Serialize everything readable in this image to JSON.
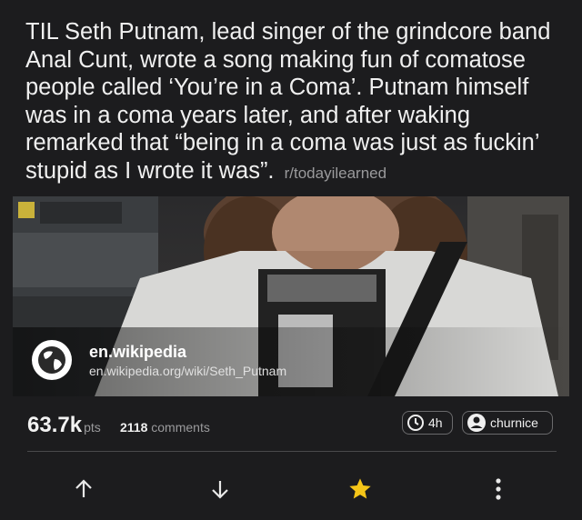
{
  "post": {
    "title": "TIL Seth Putnam, lead singer of the grindcore band Anal Cunt, wrote a song making fun of comatose people called ‘You’re in a Coma’. Putnam himself was in a coma years later, and after waking remarked that “being in a coma was just as fuckin’ stupid as I wrote it was”.",
    "subreddit": "r/todayilearned"
  },
  "link": {
    "domain": "en.wikipedia",
    "url": "en.wikipedia.org/wiki/Seth_Putnam",
    "icon": "globe-icon"
  },
  "stats": {
    "score": "63.7k",
    "score_unit": "pts",
    "comment_count": "2118",
    "comment_label": "comments",
    "age": "4h",
    "author": "churnice"
  },
  "actions": {
    "upvote_icon": "arrow-up-icon",
    "downvote_icon": "arrow-down-icon",
    "save_icon": "star-icon",
    "more_icon": "more-vertical-icon",
    "star_color": "#f5c518"
  }
}
